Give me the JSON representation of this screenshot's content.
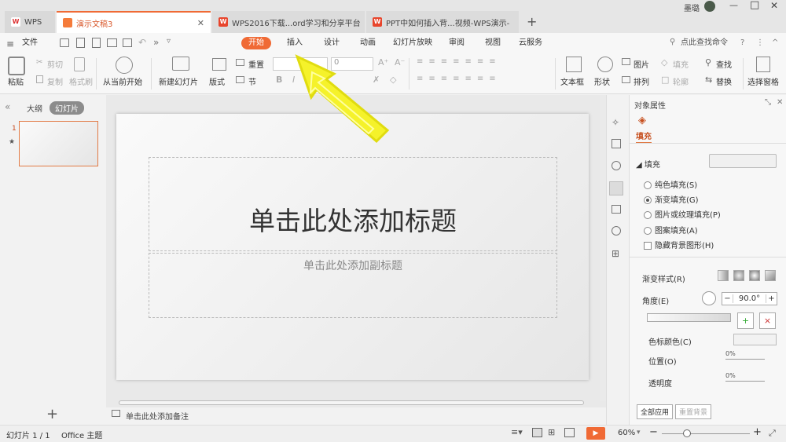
{
  "titlebar": {
    "tabs": [
      {
        "label": "WPS"
      },
      {
        "label": "演示文稿3"
      },
      {
        "label": "WPS2016下载...ord学习和分享平台"
      },
      {
        "label": "PPT中如何插入背...视频-WPS演示-"
      }
    ],
    "new_tab": "+",
    "user": "墨璐",
    "win_min": "—",
    "win_max": "□",
    "win_close": "✕"
  },
  "menu": {
    "file": "文件",
    "items": [
      "开始",
      "插入",
      "设计",
      "动画",
      "幻灯片放映",
      "审阅",
      "视图",
      "云服务"
    ],
    "search_placeholder": "点此查找命令",
    "help": "?"
  },
  "ribbon": {
    "paste": "粘贴",
    "cut": "剪切",
    "copy": "复制",
    "format_painter": "格式刷",
    "from_current": "从当前开始",
    "new_slide": "新建幻灯片",
    "layout": "版式",
    "reset": "重置",
    "section": "节",
    "font_size": "0",
    "bold": "B",
    "italic": "I",
    "text_box": "文本框",
    "shape": "形状",
    "picture": "图片",
    "arrange": "排列",
    "fill": "填充",
    "outline": "轮廓",
    "find": "查找",
    "replace": "替换",
    "select_pane": "选择窗格"
  },
  "leftpanel": {
    "collapse": "«",
    "tab_outline": "大纲",
    "tab_slides": "幻灯片",
    "thumb_number": "1",
    "thumb_star": "★",
    "add": "+"
  },
  "slide": {
    "title": "单击此处添加标题",
    "subtitle": "单击此处添加副标题"
  },
  "notes": {
    "placeholder": "单击此处添加备注"
  },
  "props": {
    "header": "对象属性",
    "tab_fill": "填充",
    "section_fill": "填充",
    "options": [
      {
        "label": "纯色填充(S)",
        "selected": false
      },
      {
        "label": "渐变填充(G)",
        "selected": true
      },
      {
        "label": "图片或纹理填充(P)",
        "selected": false
      },
      {
        "label": "图案填充(A)",
        "selected": false
      }
    ],
    "hide_bg": "隐藏背景图形(H)",
    "gradient_style": "渐变样式(R)",
    "angle_label": "角度(E)",
    "angle_value": "90.0°",
    "stop_color": "色标颜色(C)",
    "position": "位置(O)",
    "position_value": "0%",
    "transparency": "透明度",
    "transparency_value": "0%",
    "apply_all": "全部应用",
    "reset_bg": "重置背景"
  },
  "status": {
    "slide_info": "幻灯片 1 / 1",
    "theme": "Office 主题",
    "zoom": "60%",
    "zoom_minus": "−",
    "zoom_plus": "+"
  },
  "colors": {
    "accent": "#f06a35",
    "arrow": "#f5f22a"
  }
}
